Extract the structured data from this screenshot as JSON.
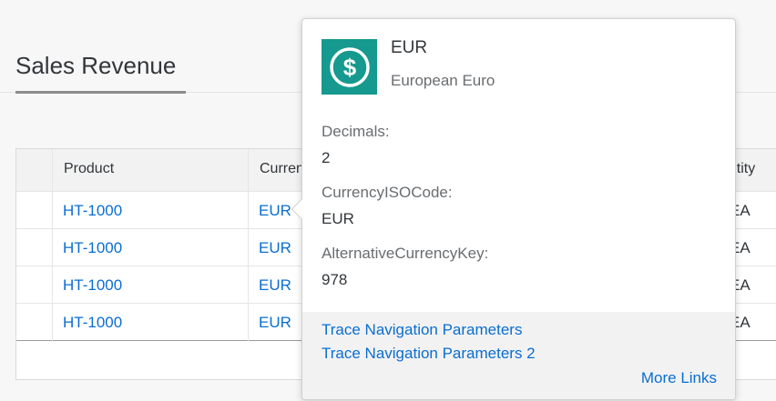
{
  "page": {
    "title": "Sales Revenue"
  },
  "table": {
    "headers": {
      "product": "Product",
      "currency": "Curren",
      "quantity": "antity"
    },
    "rows": [
      {
        "product": "HT-1000",
        "currency": "EUR",
        "quantity": "EA"
      },
      {
        "product": "HT-1000",
        "currency": "EUR",
        "quantity": "EA"
      },
      {
        "product": "HT-1000",
        "currency": "EUR",
        "quantity": "EA"
      },
      {
        "product": "HT-1000",
        "currency": "EUR",
        "quantity": "EA"
      }
    ]
  },
  "popover": {
    "icon": "dollar-sign-icon",
    "icon_color": "#16998e",
    "title": "EUR",
    "subtitle": "European Euro",
    "fields": [
      {
        "label": "Decimals:",
        "value": "2"
      },
      {
        "label": "CurrencyISOCode:",
        "value": "EUR"
      },
      {
        "label": "AlternativeCurrencyKey:",
        "value": "978"
      }
    ],
    "links": [
      "Trace Navigation Parameters",
      "Trace Navigation Parameters 2"
    ],
    "more_links": "More Links"
  },
  "colors": {
    "link": "#0a6ed1",
    "text": "#32363a",
    "muted": "#6a6d70"
  }
}
